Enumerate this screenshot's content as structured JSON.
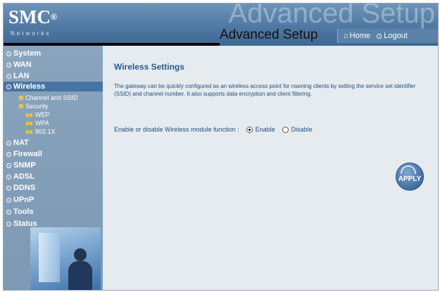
{
  "header": {
    "logo": "SMC",
    "logo_mark": "®",
    "logo_sub": "Networks",
    "watermark": "Advanced Setup",
    "title": "Advanced Setup",
    "home_label": "Home",
    "logout_label": "Logout"
  },
  "sidebar": {
    "items": [
      {
        "label": "System"
      },
      {
        "label": "WAN"
      },
      {
        "label": "LAN"
      },
      {
        "label": "Wireless"
      },
      {
        "label": "NAT"
      },
      {
        "label": "Firewall"
      },
      {
        "label": "SNMP"
      },
      {
        "label": "ADSL"
      },
      {
        "label": "DDNS"
      },
      {
        "label": "UPnP"
      },
      {
        "label": "Tools"
      },
      {
        "label": "Status"
      }
    ],
    "submenu": {
      "channel": "Channel and SSID",
      "security": "Security",
      "wep": "WEP",
      "wpa": "WPA",
      "dot1x": "802.1X"
    }
  },
  "main": {
    "title": "Wireless Settings",
    "description": "The gateway can be quickly configured as an wireless access point for roaming clients by setting the service set identifier (SSID) and channel number. It also supports data encryption and client filtering.",
    "module_label": "Enable or disable Wireless module function :",
    "enable_label": "Enable",
    "disable_label": "Disable",
    "selected": "Enable",
    "apply_label": "APPLY"
  },
  "colors": {
    "accent": "#2a5a8c",
    "header": "#4f79a3",
    "sidebar": "#8aa4bd",
    "active_item": "#4874a3",
    "content_bg": "#e6ebef"
  }
}
